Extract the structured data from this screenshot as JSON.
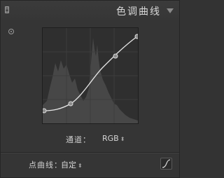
{
  "panel": {
    "title": "色调曲线"
  },
  "channel": {
    "label": "通道：",
    "value": "RGB"
  },
  "point_curve": {
    "label": "点曲线：",
    "value": "自定"
  },
  "icons": {
    "collapse": "triangle-down-icon",
    "target": "target-adjust-icon",
    "toggle": "curve-toggle-icon",
    "stepper": "updown-arrows-icon"
  },
  "colors": {
    "panel_bg": "#353535",
    "curve_bg": "#2f2f2f",
    "histogram": "#4a4a4a",
    "curve_line": "#e6e6e6",
    "text": "#d4d4d4"
  }
}
